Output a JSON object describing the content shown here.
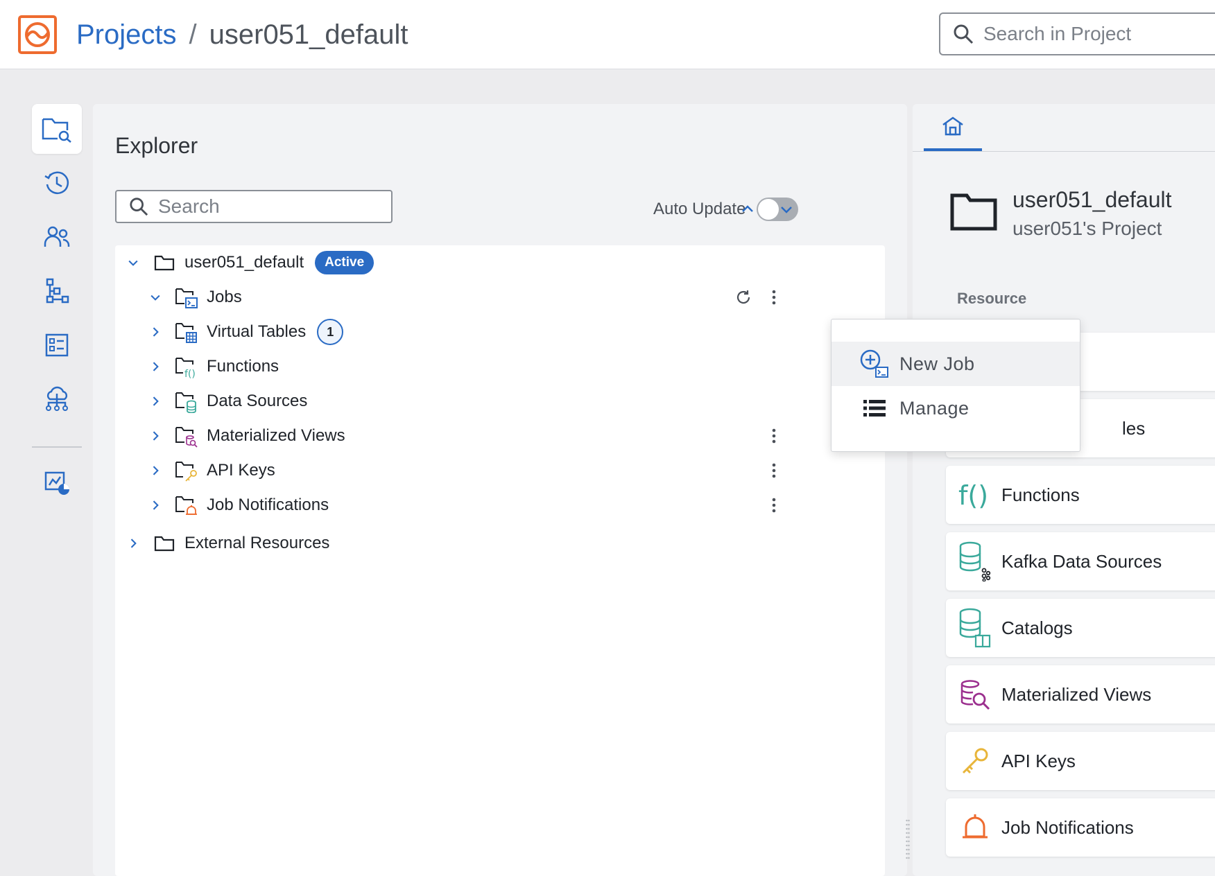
{
  "header": {
    "breadcrumb_root": "Projects",
    "breadcrumb_sep": "/",
    "breadcrumb_current": "user051_default",
    "search_placeholder": "Search in Project"
  },
  "rail": {
    "items": [
      "explorer-icon",
      "history-icon",
      "users-icon",
      "hierarchy-icon",
      "dashboard-icon",
      "cloud-network-icon",
      "monitoring-icon"
    ]
  },
  "explorer": {
    "title": "Explorer",
    "search_placeholder": "Search",
    "auto_update_label": "Auto Update",
    "auto_update_on": false,
    "root": {
      "label": "user051_default",
      "badge": "Active"
    },
    "children": [
      {
        "label": "Jobs",
        "icon": "jobs-folder-icon"
      },
      {
        "label": "Virtual Tables",
        "icon": "tables-folder-icon",
        "count": "1"
      },
      {
        "label": "Functions",
        "icon": "functions-folder-icon"
      },
      {
        "label": "Data Sources",
        "icon": "datasources-folder-icon"
      },
      {
        "label": "Materialized Views",
        "icon": "mv-folder-icon"
      },
      {
        "label": "API Keys",
        "icon": "apikeys-folder-icon"
      },
      {
        "label": "Job Notifications",
        "icon": "notifications-folder-icon"
      }
    ],
    "external": {
      "label": "External Resources"
    }
  },
  "context_menu": {
    "items": [
      {
        "label": "New Job",
        "icon": "new-job-icon"
      },
      {
        "label": "Manage",
        "icon": "list-icon"
      }
    ]
  },
  "right_panel": {
    "project_name": "user051_default",
    "project_subtitle": "user051's Project",
    "resource_heading": "Resource",
    "partial_card_text": "les",
    "cards": [
      {
        "label": "Functions",
        "icon": "functions-icon"
      },
      {
        "label": "Kafka Data Sources",
        "icon": "kafka-icon"
      },
      {
        "label": "Catalogs",
        "icon": "catalog-icon"
      },
      {
        "label": "Materialized Views",
        "icon": "materialized-views-icon"
      },
      {
        "label": "API Keys",
        "icon": "key-icon"
      },
      {
        "label": "Job Notifications",
        "icon": "bell-icon"
      }
    ]
  },
  "colors": {
    "accent": "#2a6bc4",
    "brand_orange": "#ee6b2f",
    "teal": "#3aa99b",
    "purple": "#9b2f8e",
    "gold": "#e8b53a"
  }
}
